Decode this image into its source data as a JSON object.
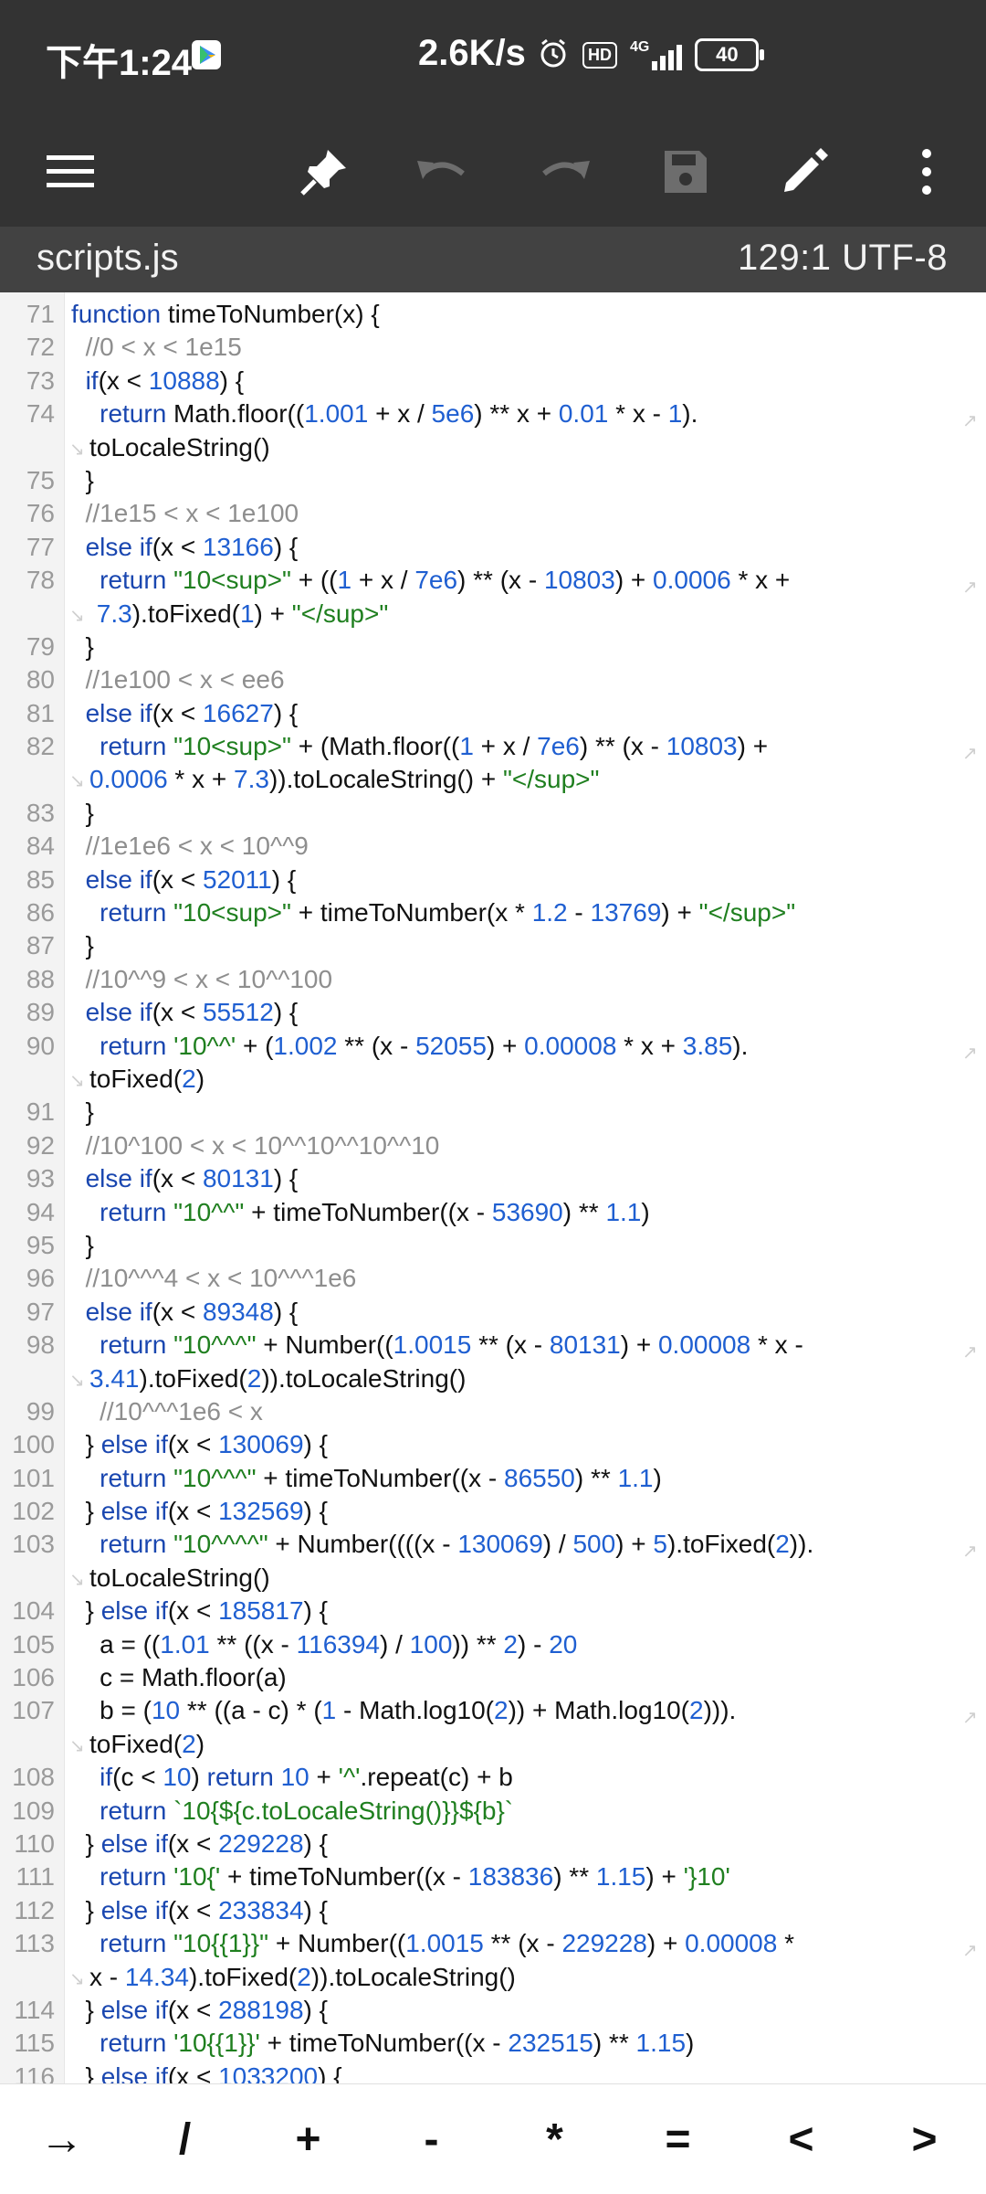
{
  "status": {
    "time": "下午1:24",
    "speed": "2.6K/s",
    "network": "4G",
    "hd": "HD",
    "battery": "40"
  },
  "toolbar": {
    "menu_icon": "hamburger-menu-icon",
    "pin_icon": "pin-icon",
    "undo_icon": "undo-icon",
    "redo_icon": "redo-icon",
    "save_icon": "save-icon",
    "edit_icon": "pencil-icon",
    "more_icon": "more-vert-icon"
  },
  "file": {
    "name": "scripts.js",
    "cursor": "129:1",
    "encoding": "UTF-8"
  },
  "colors": {
    "bar": "#333333",
    "filebar": "#424242",
    "keyword": "#1a47b0",
    "number": "#1f5fd1",
    "string": "#1f7f1f",
    "comment": "#8e8e8e"
  },
  "lines": [
    {
      "n": "71",
      "html": "<span class=\"kw\">function</span> timeToNumber(x) {"
    },
    {
      "n": "72",
      "html": "  <span class=\"cm\">//0 &lt; x &lt; 1e15</span>"
    },
    {
      "n": "73",
      "html": "  <span class=\"kw\">if</span>(x &lt; <span class=\"nm\">10888</span>) {"
    },
    {
      "n": "74",
      "html": "    <span class=\"kw\">return</span> Math.floor((<span class=\"nm\">1.001</span> + x / <span class=\"nm\">5e6</span>) ** x + <span class=\"nm\">0.01</span> * x - <span class=\"nm\">1</span>).",
      "wrap": true
    },
    {
      "n": "",
      "html": "toLocaleString()",
      "cont": true
    },
    {
      "n": "75",
      "html": "  }"
    },
    {
      "n": "76",
      "html": "  <span class=\"cm\">//1e15 &lt; x &lt; 1e100</span>"
    },
    {
      "n": "77",
      "html": "  <span class=\"kw\">else if</span>(x &lt; <span class=\"nm\">13166</span>) {"
    },
    {
      "n": "78",
      "html": "    <span class=\"kw\">return</span> <span class=\"st\">\"10&lt;sup&gt;\"</span> + ((<span class=\"nm\">1</span> + x / <span class=\"nm\">7e6</span>) ** (x - <span class=\"nm\">10803</span>) + <span class=\"nm\">0.0006</span> * x +",
      "wrap": true
    },
    {
      "n": "",
      "html": " <span class=\"nm\">7.3</span>).toFixed(<span class=\"nm\">1</span>) + <span class=\"st\">\"&lt;/sup&gt;\"</span>",
      "cont": true
    },
    {
      "n": "79",
      "html": "  }"
    },
    {
      "n": "80",
      "html": "  <span class=\"cm\">//1e100 &lt; x &lt; ee6</span>"
    },
    {
      "n": "81",
      "html": "  <span class=\"kw\">else if</span>(x &lt; <span class=\"nm\">16627</span>) {"
    },
    {
      "n": "82",
      "html": "    <span class=\"kw\">return</span> <span class=\"st\">\"10&lt;sup&gt;\"</span> + (Math.floor((<span class=\"nm\">1</span> + x / <span class=\"nm\">7e6</span>) ** (x - <span class=\"nm\">10803</span>) +",
      "wrap": true
    },
    {
      "n": "",
      "html": "<span class=\"nm\">0.0006</span> * x + <span class=\"nm\">7.3</span>)).toLocaleString() + <span class=\"st\">\"&lt;/sup&gt;\"</span>",
      "cont": true
    },
    {
      "n": "83",
      "html": "  }"
    },
    {
      "n": "84",
      "html": "  <span class=\"cm\">//1e1e6 &lt; x &lt; 10^^9</span>"
    },
    {
      "n": "85",
      "html": "  <span class=\"kw\">else if</span>(x &lt; <span class=\"nm\">52011</span>) {"
    },
    {
      "n": "86",
      "html": "    <span class=\"kw\">return</span> <span class=\"st\">\"10&lt;sup&gt;\"</span> + timeToNumber(x * <span class=\"nm\">1.2</span> - <span class=\"nm\">13769</span>) + <span class=\"st\">\"&lt;/sup&gt;\"</span>"
    },
    {
      "n": "87",
      "html": "  }"
    },
    {
      "n": "88",
      "html": "  <span class=\"cm\">//10^^9 &lt; x &lt; 10^^100</span>"
    },
    {
      "n": "89",
      "html": "  <span class=\"kw\">else if</span>(x &lt; <span class=\"nm\">55512</span>) {"
    },
    {
      "n": "90",
      "html": "    <span class=\"kw\">return</span> <span class=\"st\">'10^^'</span> + (<span class=\"nm\">1.002</span> ** (x - <span class=\"nm\">52055</span>) + <span class=\"nm\">0.00008</span> * x + <span class=\"nm\">3.85</span>).",
      "wrap": true
    },
    {
      "n": "",
      "html": "toFixed(<span class=\"nm\">2</span>)",
      "cont": true
    },
    {
      "n": "91",
      "html": "  }"
    },
    {
      "n": "92",
      "html": "  <span class=\"cm\">//10^100 &lt; x &lt; 10^^10^^10^^10</span>"
    },
    {
      "n": "93",
      "html": "  <span class=\"kw\">else if</span>(x &lt; <span class=\"nm\">80131</span>) {"
    },
    {
      "n": "94",
      "html": "    <span class=\"kw\">return</span> <span class=\"st\">\"10^^\"</span> + timeToNumber((x - <span class=\"nm\">53690</span>) ** <span class=\"nm\">1.1</span>)"
    },
    {
      "n": "95",
      "html": "  }"
    },
    {
      "n": "96",
      "html": "  <span class=\"cm\">//10^^^4 &lt; x &lt; 10^^^1e6</span>"
    },
    {
      "n": "97",
      "html": "  <span class=\"kw\">else if</span>(x &lt; <span class=\"nm\">89348</span>) {"
    },
    {
      "n": "98",
      "html": "    <span class=\"kw\">return</span> <span class=\"st\">\"10^^^\"</span> + Number((<span class=\"nm\">1.0015</span> ** (x - <span class=\"nm\">80131</span>) + <span class=\"nm\">0.00008</span> * x -",
      "wrap": true
    },
    {
      "n": "",
      "html": "<span class=\"nm\">3.41</span>).toFixed(<span class=\"nm\">2</span>)).toLocaleString()",
      "cont": true
    },
    {
      "n": "99",
      "html": "    <span class=\"cm\">//10^^^1e6 &lt; x</span>"
    },
    {
      "n": "100",
      "html": "  } <span class=\"kw\">else if</span>(x &lt; <span class=\"nm\">130069</span>) {"
    },
    {
      "n": "101",
      "html": "    <span class=\"kw\">return</span> <span class=\"st\">\"10^^^\"</span> + timeToNumber((x - <span class=\"nm\">86550</span>) ** <span class=\"nm\">1.1</span>)"
    },
    {
      "n": "102",
      "html": "  } <span class=\"kw\">else if</span>(x &lt; <span class=\"nm\">132569</span>) {"
    },
    {
      "n": "103",
      "html": "    <span class=\"kw\">return</span> <span class=\"st\">\"10^^^^\"</span> + Number((((x - <span class=\"nm\">130069</span>) / <span class=\"nm\">500</span>) + <span class=\"nm\">5</span>).toFixed(<span class=\"nm\">2</span>)).",
      "wrap": true
    },
    {
      "n": "",
      "html": "toLocaleString()",
      "cont": true
    },
    {
      "n": "104",
      "html": "  } <span class=\"kw\">else if</span>(x &lt; <span class=\"nm\">185817</span>) {"
    },
    {
      "n": "105",
      "html": "    a = ((<span class=\"nm\">1.01</span> ** ((x - <span class=\"nm\">116394</span>) / <span class=\"nm\">100</span>)) ** <span class=\"nm\">2</span>) - <span class=\"nm\">20</span>"
    },
    {
      "n": "106",
      "html": "    c = Math.floor(a)"
    },
    {
      "n": "107",
      "html": "    b = (<span class=\"nm\">10</span> ** ((a - c) * (<span class=\"nm\">1</span> - Math.log10(<span class=\"nm\">2</span>)) + Math.log10(<span class=\"nm\">2</span>))).",
      "wrap": true
    },
    {
      "n": "",
      "html": "toFixed(<span class=\"nm\">2</span>)",
      "cont": true
    },
    {
      "n": "108",
      "html": "    <span class=\"kw\">if</span>(c &lt; <span class=\"nm\">10</span>) <span class=\"kw\">return</span> <span class=\"nm\">10</span> + <span class=\"st\">'^'</span>.repeat(c) + b"
    },
    {
      "n": "109",
      "html": "    <span class=\"kw\">return</span> <span class=\"st\">`10{${c.toLocaleString()}}${b}`</span>"
    },
    {
      "n": "110",
      "html": "  } <span class=\"kw\">else if</span>(x &lt; <span class=\"nm\">229228</span>) {"
    },
    {
      "n": "111",
      "html": "    <span class=\"kw\">return</span> <span class=\"st\">'10{'</span> + timeToNumber((x - <span class=\"nm\">183836</span>) ** <span class=\"nm\">1.15</span>) + <span class=\"st\">'}10'</span>"
    },
    {
      "n": "112",
      "html": "  } <span class=\"kw\">else if</span>(x &lt; <span class=\"nm\">233834</span>) {"
    },
    {
      "n": "113",
      "html": "    <span class=\"kw\">return</span> <span class=\"st\">\"10{{1}}\"</span> + Number((<span class=\"nm\">1.0015</span> ** (x - <span class=\"nm\">229228</span>) + <span class=\"nm\">0.00008</span> *",
      "wrap": true
    },
    {
      "n": "",
      "html": "x - <span class=\"nm\">14.34</span>).toFixed(<span class=\"nm\">2</span>)).toLocaleString()",
      "cont": true
    },
    {
      "n": "114",
      "html": "  } <span class=\"kw\">else if</span>(x &lt; <span class=\"nm\">288198</span>) {"
    },
    {
      "n": "115",
      "html": "    <span class=\"kw\">return</span> <span class=\"st\">'10{{1}}'</span> + timeToNumber((x - <span class=\"nm\">232515</span>) ** <span class=\"nm\">1.15</span>)"
    },
    {
      "n": "116",
      "html": "  } <span class=\"kw\">else if</span>(x &lt; <span class=\"nm\">1033200</span>) {"
    }
  ],
  "keys": [
    "→",
    "/",
    "+",
    "-",
    "*",
    "=",
    "<",
    ">"
  ]
}
